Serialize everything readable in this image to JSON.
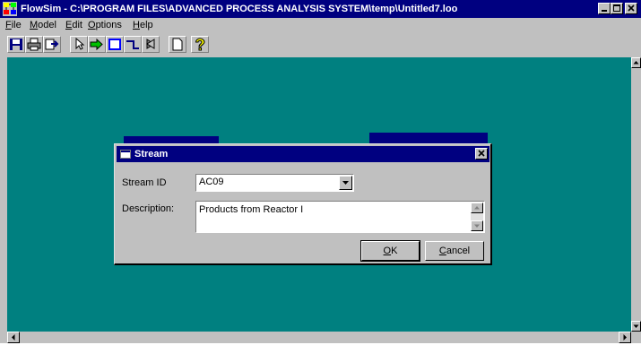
{
  "window": {
    "title": "FlowSim - C:\\PROGRAM FILES\\ADVANCED PROCESS ANALYSIS SYSTEM\\temp\\Untitled7.loo",
    "controls": [
      "minimize-icon",
      "maximize-icon",
      "close-icon"
    ]
  },
  "menu": [
    {
      "label": "File",
      "accel": "F",
      "rest": "ile"
    },
    {
      "label": "Model",
      "accel": "M",
      "rest": "odel"
    },
    {
      "label": "Edit",
      "accel": "E",
      "rest": "dit"
    },
    {
      "label": "Options",
      "accel": "O",
      "rest": "ptions"
    },
    {
      "label": "Help",
      "accel": "H",
      "rest": "elp"
    }
  ],
  "toolbar": {
    "icons": [
      "save-icon",
      "print-icon",
      "export-icon",
      "pointer-icon",
      "stream-arrow-icon",
      "unit-box-icon",
      "connector-icon",
      "valve-icon",
      "document-icon",
      "help-icon"
    ]
  },
  "dialog": {
    "title": "Stream",
    "stream_id_label": "Stream ID",
    "stream_id_value": "AC09",
    "description_label": "Description:",
    "description_value": "Products from Reactor I",
    "ok": {
      "accel": "O",
      "rest": "K"
    },
    "cancel": {
      "accel": "C",
      "rest": "ancel"
    }
  },
  "colors": {
    "titlebar": "#000080",
    "workspace": "#008080",
    "face": "#c0c0c0",
    "node": "#000080"
  }
}
